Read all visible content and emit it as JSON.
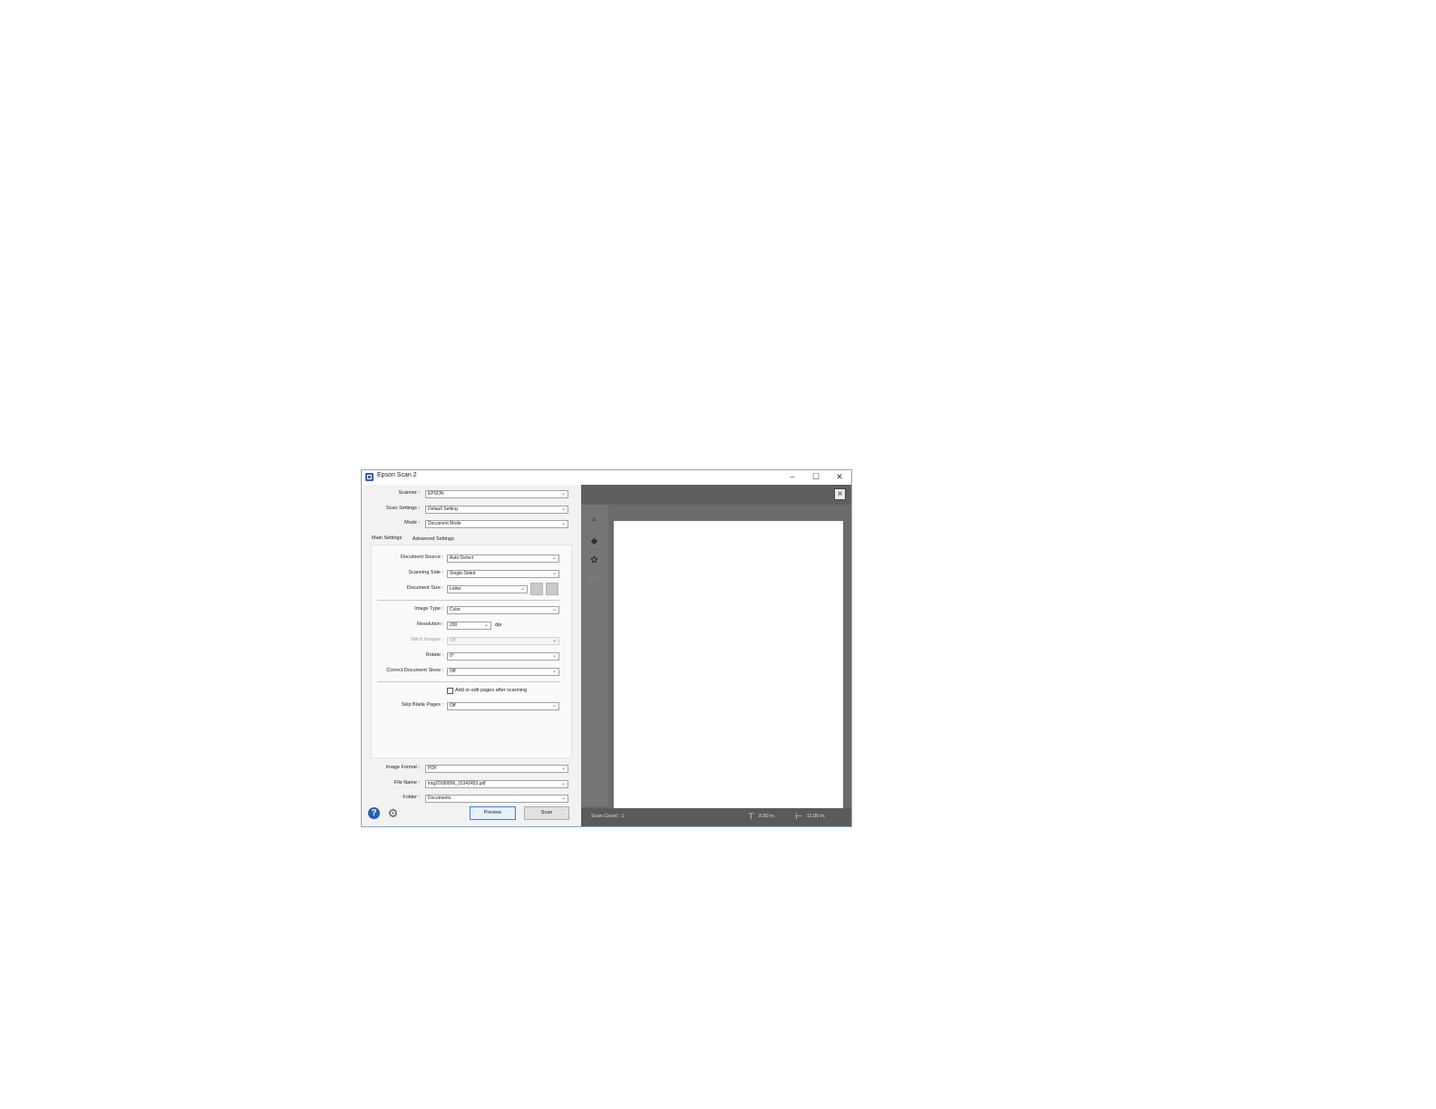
{
  "window": {
    "title": "Epson Scan 2",
    "controls": {
      "minimize": "–",
      "maximize": "☐",
      "close": "✕"
    }
  },
  "top_settings": {
    "scanner": {
      "label": "Scanner :",
      "value": "EPSON"
    },
    "scan_settings": {
      "label": "Scan Settings :",
      "value": "Default Setting"
    },
    "mode": {
      "label": "Mode :",
      "value": "Document Mode"
    }
  },
  "tabs": [
    {
      "label": "Main Settings",
      "active": true
    },
    {
      "label": "Advanced Settings",
      "active": false
    }
  ],
  "main_settings": {
    "document_source": {
      "label": "Document Source :",
      "value": "Auto Detect"
    },
    "scanning_side": {
      "label": "Scanning Side :",
      "value": "Single-Sided"
    },
    "document_size": {
      "label": "Document Size :",
      "value": "Letter"
    },
    "image_type": {
      "label": "Image Type :",
      "value": "Color"
    },
    "resolution": {
      "label": "Resolution :",
      "value": "200",
      "unit": "dpi"
    },
    "stitch_images": {
      "label": "Stitch Images :",
      "value": "Off",
      "disabled": true
    },
    "rotate": {
      "label": "Rotate :",
      "value": "0°"
    },
    "correct_skew": {
      "label": "Correct Document Skew :",
      "value": "Off"
    },
    "add_edit_pages": {
      "label": "Add or edit pages after scanning",
      "checked": false
    },
    "skip_blank": {
      "label": "Skip Blank Pages :",
      "value": "Off"
    }
  },
  "output": {
    "image_format": {
      "label": "Image Format :",
      "value": "PDF"
    },
    "file_name": {
      "label": "File Name :",
      "value": "img20180806_15342453.pdf"
    },
    "folder": {
      "label": "Folder :",
      "value": "Documents"
    }
  },
  "buttons": {
    "preview": "Preview",
    "scan": "Scan"
  },
  "icons": {
    "help": "help-icon",
    "settings": "gear-icon",
    "chevron": "⌄"
  },
  "preview_panel": {
    "scan_count": "Scan Count : 1",
    "width": "8.50 in.",
    "height": "11.00 in."
  },
  "colors": {
    "accent": "#2a5db0",
    "preview_bg": "#6b6b6b"
  }
}
